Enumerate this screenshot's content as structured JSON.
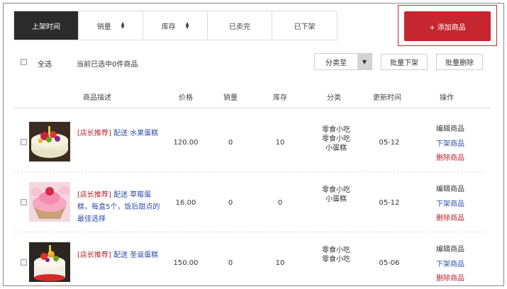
{
  "tabs": [
    {
      "label": "上架时间",
      "active": true,
      "sortable": false
    },
    {
      "label": "销量",
      "active": false,
      "sortable": true
    },
    {
      "label": "库存",
      "active": false,
      "sortable": true
    },
    {
      "label": "已卖完",
      "active": false,
      "sortable": false
    },
    {
      "label": "已下架",
      "active": false,
      "sortable": false
    }
  ],
  "add_button": {
    "label": "+ 添加商品"
  },
  "toolbar": {
    "select_all_label": "全选",
    "selected_count_text": "当前已选中0件商品",
    "category_select": {
      "value": "分类至",
      "arrow_icon": "triangle-down-icon"
    },
    "bulk_offshelf_label": "批量下架",
    "bulk_delete_label": "批量删除"
  },
  "table": {
    "headers": {
      "desc": "商品描述",
      "price": "价格",
      "sales": "销量",
      "stock": "库存",
      "category": "分类",
      "updated": "更新时间",
      "ops": "操作"
    },
    "rows": [
      {
        "tag": "[店长推荐]",
        "title": " 配送 水果蛋糕",
        "price": "120.00",
        "sales": "0",
        "stock": "10",
        "categories": [
          "零食小吃",
          "零食小吃",
          "小蛋糕"
        ],
        "updated": "05-12",
        "ops": [
          "编辑商品",
          "下架商品",
          "删除商品"
        ],
        "image": "fruit-cake"
      },
      {
        "tag": "[店长推荐]",
        "title": " 配送 草莓蛋糕，每盒5个，饭后甜点的最佳选择",
        "price": "16.00",
        "sales": "0",
        "stock": "0",
        "categories": [
          "零食小吃",
          "小蛋糕"
        ],
        "updated": "05-12",
        "ops": [
          "编辑商品",
          "下架商品",
          "删除商品"
        ],
        "image": "strawberry-cupcake"
      },
      {
        "tag": "[店长推荐]",
        "title": " 配送 圣诞蛋糕",
        "price": "150.00",
        "sales": "0",
        "stock": "10",
        "categories": [
          "零食小吃",
          "零食小吃"
        ],
        "updated": "05-06",
        "ops": [
          "编辑商品",
          "下架商品",
          "删除商品"
        ],
        "image": "christmas-cake"
      }
    ]
  },
  "colors": {
    "accent_red": "#c6262f",
    "active_tab": "#2b2b2b",
    "link_blue": "#2a4ea8",
    "delete_red": "#b3262d"
  }
}
